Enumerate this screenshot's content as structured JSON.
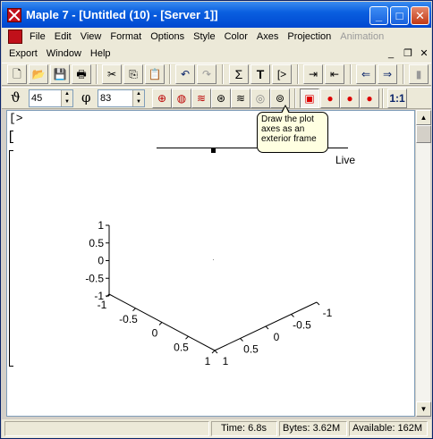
{
  "window": {
    "title": "Maple 7  - [Untitled (10) - [Server 1]]",
    "controls": {
      "minimize": "_",
      "maximize": "□",
      "close": "✕"
    }
  },
  "menu": {
    "row1": [
      "File",
      "Edit",
      "View",
      "Format",
      "Options",
      "Style",
      "Color",
      "Axes",
      "Projection",
      "Animation"
    ],
    "row1_disabled": [
      "Animation"
    ],
    "row2": [
      "Export",
      "Window",
      "Help"
    ]
  },
  "toolbar": {
    "theta_symbol": "ϑ",
    "theta_value": "45",
    "phi_symbol": "φ",
    "phi_value": "83",
    "prompt_glyph": "[>",
    "ratio_label": "1:1"
  },
  "tooltip": {
    "text": "Draw the plot axes as an exterior frame"
  },
  "document": {
    "prompt": "[>",
    "bracket": "[",
    "live_label": "Live"
  },
  "chart_data": {
    "type": "surface-3d",
    "z_ticks": [
      "1",
      "0.5",
      "0",
      "-0.5",
      "-1"
    ],
    "x_ticks": [
      "-1",
      "-0.5",
      "0",
      "0.5",
      "1"
    ],
    "y_ticks": [
      "-1",
      "-0.5",
      "0",
      "0.5",
      "1"
    ],
    "z_range": [
      -1,
      1
    ],
    "x_range": [
      -1,
      1
    ],
    "y_range": [
      -1,
      1
    ],
    "axes_style": "frame"
  },
  "status": {
    "time": "Time:   6.8s",
    "bytes": "Bytes: 3.62M",
    "available": "Available: 162M"
  }
}
